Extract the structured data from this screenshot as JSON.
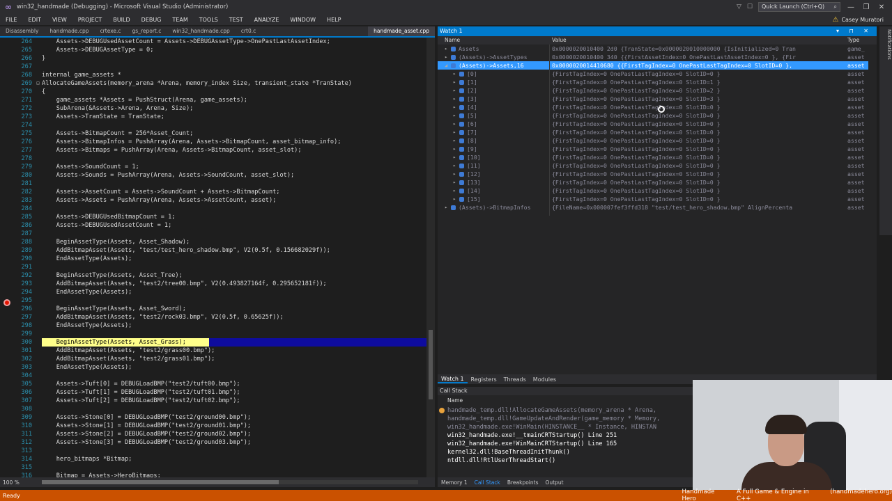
{
  "titlebar": {
    "title": "win32_handmade (Debugging) - Microsoft Visual Studio (Administrator)",
    "quick_launch": "Quick Launch (Ctrl+Q)",
    "search_glyph": "⌕",
    "min": "—",
    "max": "❐",
    "close": "✕"
  },
  "menubar": {
    "items": [
      "FILE",
      "EDIT",
      "VIEW",
      "PROJECT",
      "BUILD",
      "DEBUG",
      "TEAM",
      "TOOLS",
      "TEST",
      "ANALYZE",
      "WINDOW",
      "HELP"
    ],
    "user": "Casey Muratori"
  },
  "doctabs": [
    "Disassembly",
    "handmade.cpp",
    "crtexe.c",
    "gs_report.c",
    "win32_handmade.cpp",
    "crt0.c",
    "handmade_asset.cpp"
  ],
  "editor": {
    "lines": [
      {
        "n": "264",
        "t": "    Assets->DEBUGUsedAssetCount = Assets->DEBUGAssetType->OnePastLastAssetIndex;"
      },
      {
        "n": "265",
        "t": "    Assets->DEBUGAssetType = 0;"
      },
      {
        "n": "266",
        "t": "}"
      },
      {
        "n": "267",
        "t": ""
      },
      {
        "n": "268",
        "t": "internal game_assets *"
      },
      {
        "n": "269",
        "t": "AllocateGameAssets(memory_arena *Arena, memory_index Size, transient_state *TranState)"
      },
      {
        "n": "270",
        "t": "{"
      },
      {
        "n": "271",
        "t": "    game_assets *Assets = PushStruct(Arena, game_assets);"
      },
      {
        "n": "272",
        "t": "    SubArena(&Assets->Arena, Arena, Size);"
      },
      {
        "n": "273",
        "t": "    Assets->TranState = TranState;"
      },
      {
        "n": "274",
        "t": ""
      },
      {
        "n": "275",
        "t": "    Assets->BitmapCount = 256*Asset_Count;"
      },
      {
        "n": "276",
        "t": "    Assets->BitmapInfos = PushArray(Arena, Assets->BitmapCount, asset_bitmap_info);"
      },
      {
        "n": "277",
        "t": "    Assets->Bitmaps = PushArray(Arena, Assets->BitmapCount, asset_slot);"
      },
      {
        "n": "278",
        "t": ""
      },
      {
        "n": "279",
        "t": "    Assets->SoundCount = 1;"
      },
      {
        "n": "280",
        "t": "    Assets->Sounds = PushArray(Arena, Assets->SoundCount, asset_slot);"
      },
      {
        "n": "281",
        "t": ""
      },
      {
        "n": "282",
        "t": "    Assets->AssetCount = Assets->SoundCount + Assets->BitmapCount;"
      },
      {
        "n": "283",
        "t": "    Assets->Assets = PushArray(Arena, Assets->AssetCount, asset);"
      },
      {
        "n": "284",
        "t": ""
      },
      {
        "n": "285",
        "t": "    Assets->DEBUGUsedBitmapCount = 1;"
      },
      {
        "n": "286",
        "t": "    Assets->DEBUGUsedAssetCount = 1;"
      },
      {
        "n": "287",
        "t": ""
      },
      {
        "n": "288",
        "t": "    BeginAssetType(Assets, Asset_Shadow);"
      },
      {
        "n": "289",
        "t": "    AddBitmapAsset(Assets, \"test/test_hero_shadow.bmp\", V2(0.5f, 0.156682029f));"
      },
      {
        "n": "290",
        "t": "    EndAssetType(Assets);"
      },
      {
        "n": "291",
        "t": ""
      },
      {
        "n": "292",
        "t": "    BeginAssetType(Assets, Asset_Tree);"
      },
      {
        "n": "293",
        "t": "    AddBitmapAsset(Assets, \"test2/tree00.bmp\", V2(0.493827164f, 0.295652181f));"
      },
      {
        "n": "294",
        "t": "    EndAssetType(Assets);"
      },
      {
        "n": "295",
        "t": ""
      },
      {
        "n": "296",
        "t": "    BeginAssetType(Assets, Asset_Sword);"
      },
      {
        "n": "297",
        "t": "    AddBitmapAsset(Assets, \"test2/rock03.bmp\", V2(0.5f, 0.65625f));"
      },
      {
        "n": "298",
        "t": "    EndAssetType(Assets);"
      },
      {
        "n": "299",
        "t": ""
      },
      {
        "n": "300",
        "t": "    BeginAssetType(Assets, Asset_Grass);"
      },
      {
        "n": "301",
        "t": "    AddBitmapAsset(Assets, \"test2/grass00.bmp\");"
      },
      {
        "n": "302",
        "t": "    AddBitmapAsset(Assets, \"test2/grass01.bmp\");"
      },
      {
        "n": "303",
        "t": "    EndAssetType(Assets);"
      },
      {
        "n": "304",
        "t": ""
      },
      {
        "n": "305",
        "t": "    Assets->Tuft[0] = DEBUGLoadBMP(\"test2/tuft00.bmp\");"
      },
      {
        "n": "306",
        "t": "    Assets->Tuft[1] = DEBUGLoadBMP(\"test2/tuft01.bmp\");"
      },
      {
        "n": "307",
        "t": "    Assets->Tuft[2] = DEBUGLoadBMP(\"test2/tuft02.bmp\");"
      },
      {
        "n": "308",
        "t": ""
      },
      {
        "n": "309",
        "t": "    Assets->Stone[0] = DEBUGLoadBMP(\"test2/ground00.bmp\");"
      },
      {
        "n": "310",
        "t": "    Assets->Stone[1] = DEBUGLoadBMP(\"test2/ground01.bmp\");"
      },
      {
        "n": "311",
        "t": "    Assets->Stone[2] = DEBUGLoadBMP(\"test2/ground02.bmp\");"
      },
      {
        "n": "312",
        "t": "    Assets->Stone[3] = DEBUGLoadBMP(\"test2/ground03.bmp\");"
      },
      {
        "n": "313",
        "t": ""
      },
      {
        "n": "314",
        "t": "    hero_bitmaps *Bitmap;"
      },
      {
        "n": "315",
        "t": ""
      },
      {
        "n": "316",
        "t": "    Bitmap = Assets->HeroBitmaps;"
      }
    ],
    "zoom": "100 %"
  },
  "watch": {
    "title": "Watch 1",
    "title_buttons": "▾ ⊓ ✕",
    "col_name": "Name",
    "col_value": "Value",
    "col_type": "Type",
    "rows": [
      {
        "name": "Assets",
        "value": "0x0000020010400 2d0 {TranState=0x0000020010000000 {IsInitialized=0 Tran",
        "type": "game_",
        "depth": 0,
        "exp": "▸",
        "sel": false
      },
      {
        "name": "(Assets)->AssetTypes",
        "value": "0x0000020010400 340 {{FirstAssetIndex=0 OnePastLastAssetIndex=0 }, {Fir",
        "type": "asset",
        "depth": 0,
        "exp": "▸",
        "sel": false
      },
      {
        "name": "(Assets)->Assets,16",
        "value": "0x0000020014410680 {{FirstTagIndex=0 OnePastLastTagIndex=0 SlotID=0 }, ",
        "type": "asset",
        "depth": 0,
        "exp": "◢",
        "sel": true
      },
      {
        "name": "[0]",
        "value": "{FirstTagIndex=0 OnePastLastTagIndex=0 SlotID=0 }",
        "type": "asset",
        "depth": 1,
        "exp": "▸",
        "sel": false
      },
      {
        "name": "[1]",
        "value": "{FirstTagIndex=0 OnePastLastTagIndex=0 SlotID=1 }",
        "type": "asset",
        "depth": 1,
        "exp": "▸",
        "sel": false
      },
      {
        "name": "[2]",
        "value": "{FirstTagIndex=0 OnePastLastTagIndex=0 SlotID=2 }",
        "type": "asset",
        "depth": 1,
        "exp": "▸",
        "sel": false
      },
      {
        "name": "[3]",
        "value": "{FirstTagIndex=0 OnePastLastTagIndex=0 SlotID=3 }",
        "type": "asset",
        "depth": 1,
        "exp": "▸",
        "sel": false
      },
      {
        "name": "[4]",
        "value": "{FirstTagIndex=0 OnePastLastTagIndex=0 SlotID=0 }",
        "type": "asset",
        "depth": 1,
        "exp": "▸",
        "sel": false
      },
      {
        "name": "[5]",
        "value": "{FirstTagIndex=0 OnePastLastTagIndex=0 SlotID=0 }",
        "type": "asset",
        "depth": 1,
        "exp": "▸",
        "sel": false
      },
      {
        "name": "[6]",
        "value": "{FirstTagIndex=0 OnePastLastTagIndex=0 SlotID=0 }",
        "type": "asset",
        "depth": 1,
        "exp": "▸",
        "sel": false
      },
      {
        "name": "[7]",
        "value": "{FirstTagIndex=0 OnePastLastTagIndex=0 SlotID=0 }",
        "type": "asset",
        "depth": 1,
        "exp": "▸",
        "sel": false
      },
      {
        "name": "[8]",
        "value": "{FirstTagIndex=0 OnePastLastTagIndex=0 SlotID=0 }",
        "type": "asset",
        "depth": 1,
        "exp": "▸",
        "sel": false
      },
      {
        "name": "[9]",
        "value": "{FirstTagIndex=0 OnePastLastTagIndex=0 SlotID=0 }",
        "type": "asset",
        "depth": 1,
        "exp": "▸",
        "sel": false
      },
      {
        "name": "[10]",
        "value": "{FirstTagIndex=0 OnePastLastTagIndex=0 SlotID=0 }",
        "type": "asset",
        "depth": 1,
        "exp": "▸",
        "sel": false
      },
      {
        "name": "[11]",
        "value": "{FirstTagIndex=0 OnePastLastTagIndex=0 SlotID=0 }",
        "type": "asset",
        "depth": 1,
        "exp": "▸",
        "sel": false
      },
      {
        "name": "[12]",
        "value": "{FirstTagIndex=0 OnePastLastTagIndex=0 SlotID=0 }",
        "type": "asset",
        "depth": 1,
        "exp": "▸",
        "sel": false
      },
      {
        "name": "[13]",
        "value": "{FirstTagIndex=0 OnePastLastTagIndex=0 SlotID=0 }",
        "type": "asset",
        "depth": 1,
        "exp": "▸",
        "sel": false
      },
      {
        "name": "[14]",
        "value": "{FirstTagIndex=0 OnePastLastTagIndex=0 SlotID=0 }",
        "type": "asset",
        "depth": 1,
        "exp": "▸",
        "sel": false
      },
      {
        "name": "[15]",
        "value": "{FirstTagIndex=0 OnePastLastTagIndex=0 SlotID=0 }",
        "type": "asset",
        "depth": 1,
        "exp": "▸",
        "sel": false
      },
      {
        "name": "(Assets)->BitmapInfos",
        "value": "{FileName=0x000007fef3ffd318 \"test/test_hero_shadow.bmp\" AlignPercenta",
        "type": "asset",
        "depth": 0,
        "exp": "▸",
        "sel": false
      }
    ]
  },
  "debug_tabs": [
    "Watch 1",
    "Registers",
    "Threads",
    "Modules"
  ],
  "callstack": {
    "title": "Call Stack",
    "col_name": "Name",
    "rows": [
      {
        "t": "handmade_temp.dll!AllocateGameAssets(memory_arena * Arena, ",
        "dim": true
      },
      {
        "t": "handmade_temp.dll!GameUpdateAndRender(game_memory * Memory,",
        "dim": true
      },
      {
        "t": "win32_handmade.exe!WinMain(HINSTANCE__ * Instance, HINSTAN",
        "dim": true
      },
      {
        "t": "win32_handmade.exe!__tmainCRTStartup() Line 251",
        "dim": false
      },
      {
        "t": "win32_handmade.exe!WinMainCRTStartup() Line 165",
        "dim": false
      },
      {
        "t": "kernel32.dll!BaseThreadInitThunk()",
        "dim": false
      },
      {
        "t": "ntdll.dll!RtlUserThreadStart()",
        "dim": false
      }
    ]
  },
  "bottom_tabs": [
    "Memory 1",
    "Call Stack",
    "Breakpoints",
    "Output"
  ],
  "status": {
    "ready": "Ready",
    "banner": [
      "Handmade Hero",
      "A Full Game & Engine in C++",
      "(handmadehero.org)"
    ]
  },
  "side_strip": "Notifications",
  "colors": {
    "accent": "#007acc",
    "status": "#ca5100",
    "selection": "#3399ff",
    "breakpoint": "#e51400"
  }
}
